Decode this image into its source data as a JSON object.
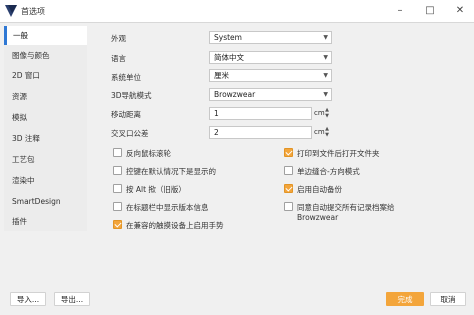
{
  "window": {
    "title": "首选项"
  },
  "sidebar": {
    "items": [
      {
        "label": "一般",
        "active": true
      },
      {
        "label": "图像与颜色"
      },
      {
        "label": "2D 窗口"
      },
      {
        "label": "资源"
      },
      {
        "label": "模拟"
      },
      {
        "label": "3D 注释"
      },
      {
        "label": "工艺包"
      },
      {
        "label": "渲染中"
      },
      {
        "label": "SmartDesign"
      },
      {
        "label": "插件"
      }
    ]
  },
  "settings": {
    "appearance": {
      "label": "外观",
      "value": "System"
    },
    "language": {
      "label": "语言",
      "value": "简体中文"
    },
    "units": {
      "label": "系统单位",
      "value": "厘米"
    },
    "nav_mode": {
      "label": "3D导航模式",
      "value": "Browzwear"
    },
    "move_distance": {
      "label": "移动距离",
      "value": "1",
      "unit": "cm"
    },
    "intersection_tolerance": {
      "label": "交叉口公差",
      "value": "2",
      "unit": "cm"
    }
  },
  "options_left": [
    {
      "label": "反向鼠标滚轮",
      "checked": false
    },
    {
      "label": "控键在默认情况下是显示的",
      "checked": false
    },
    {
      "label": "按 Alt 揿（旧版）",
      "checked": false
    },
    {
      "label": "在标题栏中显示版本信息",
      "checked": false
    },
    {
      "label": "在兼容的触摸设备上启用手势",
      "checked": true
    }
  ],
  "options_right": [
    {
      "label": "打印到文件后打开文件夹",
      "checked": true
    },
    {
      "label": "单边缝合-方向模式",
      "checked": false
    },
    {
      "label": "启用自动备份",
      "checked": true
    },
    {
      "label": "同意自动提交所有记录档案给",
      "label2": "Browzwear",
      "checked": false
    }
  ],
  "footer": {
    "import_label": "导入...",
    "export_label": "导出...",
    "ok_label": "完成",
    "cancel_label": "取消"
  },
  "colors": {
    "accent": "#f3a53b",
    "active_marker": "#2f78d4"
  }
}
